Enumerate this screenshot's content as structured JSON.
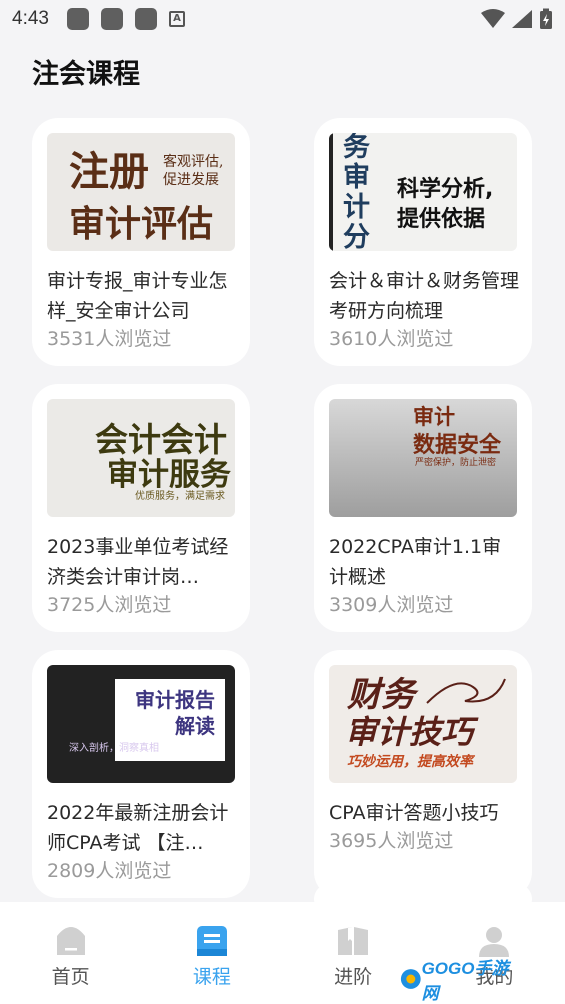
{
  "status_bar": {
    "time": "4:43",
    "notif_letter": "A"
  },
  "page_title": "注会课程",
  "courses": [
    {
      "title": "审计专报_审计专业怎样_安全审计公司",
      "views": "3531人浏览过",
      "thumb": {
        "big1": "注册",
        "big2": "审计评估",
        "small": "客观评估,\n促进发展"
      }
    },
    {
      "title": "会计＆审计＆财务管理考研方向梳理",
      "views": "3610人浏览过",
      "thumb": {
        "vertical": "务审计分析",
        "main": "科学分析,\n提供依据"
      }
    },
    {
      "title": "2023事业单位考试经济类会计审计岗…",
      "views": "3725人浏览过",
      "thumb": {
        "line1": "会计会计",
        "line2": "审计服务",
        "small": "优质服务，满足需求"
      }
    },
    {
      "title": "2022CPA审计1.1审计概述",
      "views": "3309人浏览过",
      "thumb": {
        "line1": "审计",
        "line2": "数据安全",
        "small": "严密保护，防止泄密"
      }
    },
    {
      "title": "2022年最新注册会计师CPA考试 【注…",
      "views": "2809人浏览过",
      "thumb": {
        "box": "审计报告\n解读",
        "small": "深入剖析，洞察真相"
      }
    },
    {
      "title": "CPA审计答题小技巧",
      "views": "3695人浏览过",
      "thumb": {
        "line1": "财务",
        "line2": "审计技巧",
        "small": "巧妙运用，提高效率"
      }
    }
  ],
  "tabs": [
    {
      "label": "首页",
      "icon": "home-icon"
    },
    {
      "label": "课程",
      "icon": "course-icon"
    },
    {
      "label": "进阶",
      "icon": "book-icon"
    },
    {
      "label": "我的",
      "icon": "user-icon"
    }
  ],
  "watermark": "GOGO手游网",
  "colors": {
    "accent": "#3aa3ee",
    "card_bg": "#ffffff",
    "page_bg": "#f4f4f6"
  }
}
